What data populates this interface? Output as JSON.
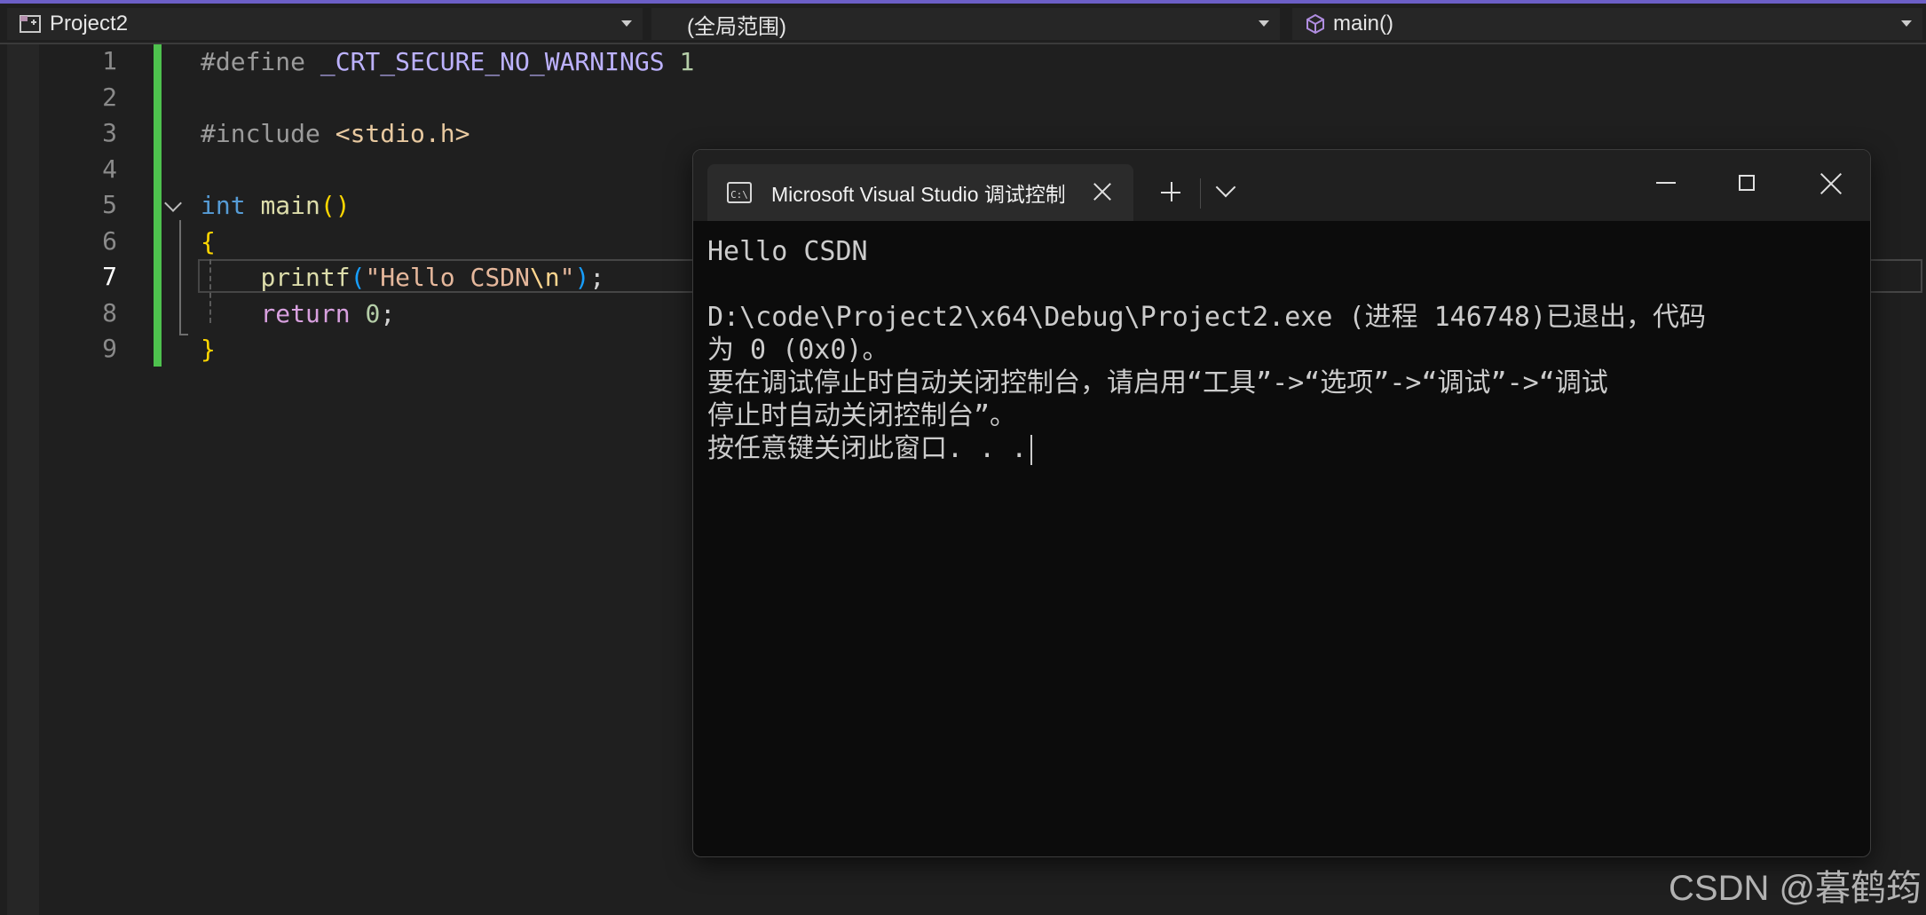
{
  "navigation_bar": {
    "project_combo": {
      "label": "Project2",
      "icon": "project-icon"
    },
    "scope_combo": {
      "label": "(全局范围)"
    },
    "member_combo": {
      "label": "main()",
      "icon": "cube-icon"
    }
  },
  "editor": {
    "current_line": 7,
    "lines": [
      {
        "number": "1",
        "tokens": [
          {
            "t": "#define ",
            "c": "pre"
          },
          {
            "t": "_CRT_SECURE_NO_WARNINGS",
            "c": "macro"
          },
          {
            "t": " ",
            "c": "plain"
          },
          {
            "t": "1",
            "c": "num"
          }
        ]
      },
      {
        "number": "2",
        "tokens": []
      },
      {
        "number": "3",
        "tokens": [
          {
            "t": "#include ",
            "c": "pre"
          },
          {
            "t": "<stdio.h>",
            "c": "inc"
          }
        ]
      },
      {
        "number": "4",
        "tokens": []
      },
      {
        "number": "5",
        "tokens": [
          {
            "t": "int",
            "c": "kw"
          },
          {
            "t": " ",
            "c": "plain"
          },
          {
            "t": "main",
            "c": "fn"
          },
          {
            "t": "()",
            "c": "br1"
          }
        ]
      },
      {
        "number": "6",
        "tokens": [
          {
            "t": "{",
            "c": "br1"
          }
        ]
      },
      {
        "number": "7",
        "tokens": [
          {
            "t": "    ",
            "c": "plain"
          },
          {
            "t": "printf",
            "c": "fn"
          },
          {
            "t": "(",
            "c": "br3"
          },
          {
            "t": "\"Hello CSDN",
            "c": "str"
          },
          {
            "t": "\\n",
            "c": "esc"
          },
          {
            "t": "\"",
            "c": "str"
          },
          {
            "t": ")",
            "c": "br3"
          },
          {
            "t": ";",
            "c": "plain"
          }
        ]
      },
      {
        "number": "8",
        "tokens": [
          {
            "t": "    ",
            "c": "plain"
          },
          {
            "t": "return",
            "c": "ret"
          },
          {
            "t": " ",
            "c": "plain"
          },
          {
            "t": "0",
            "c": "num"
          },
          {
            "t": ";",
            "c": "plain"
          }
        ]
      },
      {
        "number": "9",
        "tokens": [
          {
            "t": "}",
            "c": "br1"
          }
        ]
      }
    ]
  },
  "terminal": {
    "tab_title": "Microsoft Visual Studio 调试控制台",
    "tab_icon": "console-icon",
    "new_tab_label": "+",
    "output_lines": [
      "Hello CSDN",
      "",
      "D:\\code\\Project2\\x64\\Debug\\Project2.exe (进程 146748)已退出，代码",
      "为 0 (0x0)。",
      "要在调试停止时自动关闭控制台，请启用“工具”->“选项”->“调试”->“调试",
      "停止时自动关闭控制台”。",
      "按任意键关闭此窗口. . ."
    ]
  },
  "watermark": {
    "text": "CSDN @暮鹤筠"
  },
  "colors": {
    "accent": "#6c5fc7",
    "change_bar": "#4ec24e",
    "editor_bg": "#1f1f1f",
    "terminal_bg": "#0c0c0c"
  }
}
